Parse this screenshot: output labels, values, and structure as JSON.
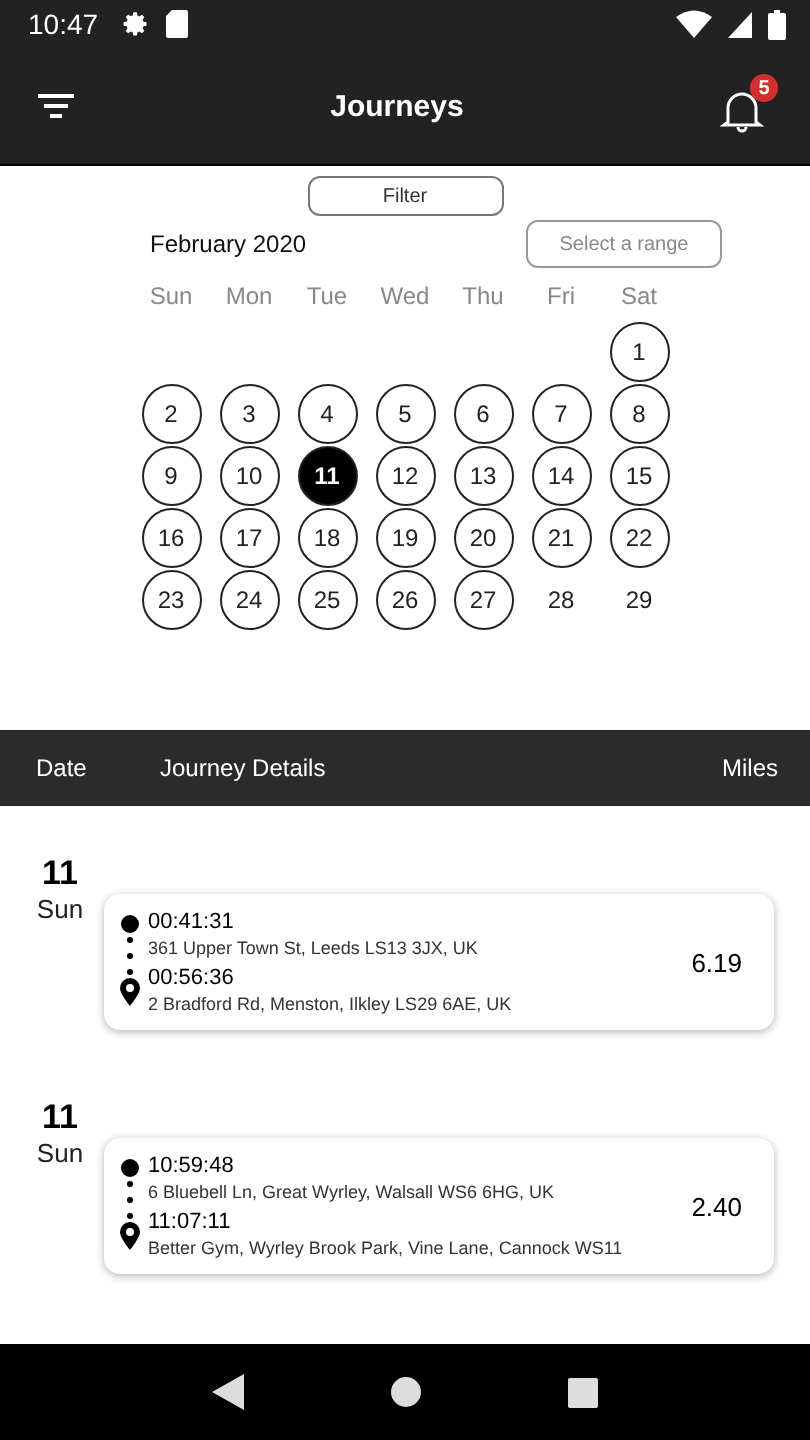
{
  "status_bar": {
    "time": "10:47"
  },
  "app_bar": {
    "title": "Journeys",
    "notification_count": "5"
  },
  "filter_button": "Filter",
  "calendar": {
    "month": "February 2020",
    "range_placeholder": "Select a range",
    "weekdays": [
      "Sun",
      "Mon",
      "Tue",
      "Wed",
      "Thu",
      "Fri",
      "Sat"
    ],
    "weeks": [
      [
        {
          "label": "1",
          "has_journey": true,
          "selected": false
        }
      ],
      [
        {
          "label": "2",
          "has_journey": true,
          "selected": false
        },
        {
          "label": "3",
          "has_journey": true,
          "selected": false
        },
        {
          "label": "4",
          "has_journey": true,
          "selected": false
        },
        {
          "label": "5",
          "has_journey": true,
          "selected": false
        },
        {
          "label": "6",
          "has_journey": true,
          "selected": false
        },
        {
          "label": "7",
          "has_journey": true,
          "selected": false
        },
        {
          "label": "8",
          "has_journey": true,
          "selected": false
        }
      ],
      [
        {
          "label": "9",
          "has_journey": true,
          "selected": false
        },
        {
          "label": "10",
          "has_journey": true,
          "selected": false
        },
        {
          "label": "11",
          "has_journey": true,
          "selected": true
        },
        {
          "label": "12",
          "has_journey": true,
          "selected": false
        },
        {
          "label": "13",
          "has_journey": true,
          "selected": false
        },
        {
          "label": "14",
          "has_journey": true,
          "selected": false
        },
        {
          "label": "15",
          "has_journey": true,
          "selected": false
        }
      ],
      [
        {
          "label": "16",
          "has_journey": true,
          "selected": false
        },
        {
          "label": "17",
          "has_journey": true,
          "selected": false
        },
        {
          "label": "18",
          "has_journey": true,
          "selected": false
        },
        {
          "label": "19",
          "has_journey": true,
          "selected": false
        },
        {
          "label": "20",
          "has_journey": true,
          "selected": false
        },
        {
          "label": "21",
          "has_journey": true,
          "selected": false
        },
        {
          "label": "22",
          "has_journey": true,
          "selected": false
        }
      ],
      [
        {
          "label": "23",
          "has_journey": true,
          "selected": false
        },
        {
          "label": "24",
          "has_journey": true,
          "selected": false
        },
        {
          "label": "25",
          "has_journey": true,
          "selected": false
        },
        {
          "label": "26",
          "has_journey": true,
          "selected": false
        },
        {
          "label": "27",
          "has_journey": true,
          "selected": false
        },
        {
          "label": "28",
          "has_journey": false,
          "selected": false
        },
        {
          "label": "29",
          "has_journey": false,
          "selected": false
        }
      ]
    ]
  },
  "table": {
    "columns": [
      "Date",
      "Journey Details",
      "Miles"
    ],
    "rows": [
      {
        "day": "11",
        "weekday": "Sun",
        "start_time": "00:41:31",
        "start_address": "361 Upper Town St, Leeds LS13 3JX, UK",
        "end_time": "00:56:36",
        "end_address": "2 Bradford Rd, Menston, Ilkley LS29 6AE, UK",
        "miles": "6.19"
      },
      {
        "day": "11",
        "weekday": "Sun",
        "start_time": "10:59:48",
        "start_address": "6 Bluebell Ln, Great Wyrley, Walsall WS6 6HG, UK",
        "end_time": "11:07:11",
        "end_address": "Better Gym, Wyrley Brook Park, Vine Lane, Cannock WS11",
        "miles": "2.40"
      }
    ]
  }
}
